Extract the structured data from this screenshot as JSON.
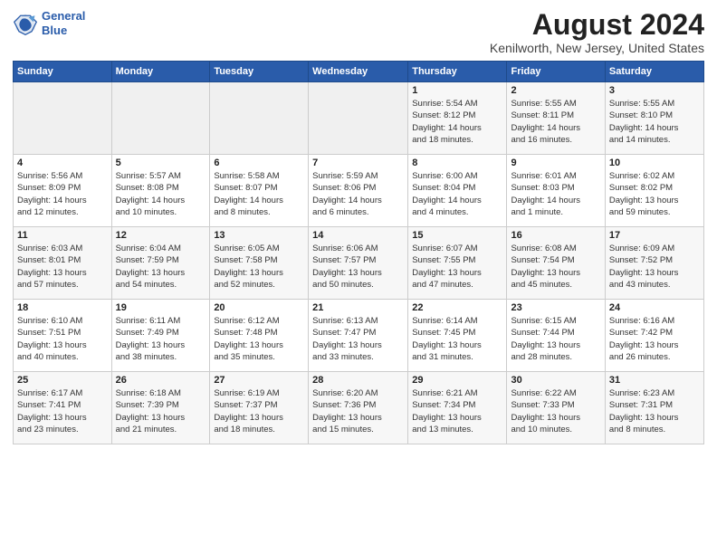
{
  "header": {
    "logo_line1": "General",
    "logo_line2": "Blue",
    "main_title": "August 2024",
    "sub_title": "Kenilworth, New Jersey, United States"
  },
  "weekdays": [
    "Sunday",
    "Monday",
    "Tuesday",
    "Wednesday",
    "Thursday",
    "Friday",
    "Saturday"
  ],
  "weeks": [
    [
      {
        "day": "",
        "info": ""
      },
      {
        "day": "",
        "info": ""
      },
      {
        "day": "",
        "info": ""
      },
      {
        "day": "",
        "info": ""
      },
      {
        "day": "1",
        "info": "Sunrise: 5:54 AM\nSunset: 8:12 PM\nDaylight: 14 hours\nand 18 minutes."
      },
      {
        "day": "2",
        "info": "Sunrise: 5:55 AM\nSunset: 8:11 PM\nDaylight: 14 hours\nand 16 minutes."
      },
      {
        "day": "3",
        "info": "Sunrise: 5:55 AM\nSunset: 8:10 PM\nDaylight: 14 hours\nand 14 minutes."
      }
    ],
    [
      {
        "day": "4",
        "info": "Sunrise: 5:56 AM\nSunset: 8:09 PM\nDaylight: 14 hours\nand 12 minutes."
      },
      {
        "day": "5",
        "info": "Sunrise: 5:57 AM\nSunset: 8:08 PM\nDaylight: 14 hours\nand 10 minutes."
      },
      {
        "day": "6",
        "info": "Sunrise: 5:58 AM\nSunset: 8:07 PM\nDaylight: 14 hours\nand 8 minutes."
      },
      {
        "day": "7",
        "info": "Sunrise: 5:59 AM\nSunset: 8:06 PM\nDaylight: 14 hours\nand 6 minutes."
      },
      {
        "day": "8",
        "info": "Sunrise: 6:00 AM\nSunset: 8:04 PM\nDaylight: 14 hours\nand 4 minutes."
      },
      {
        "day": "9",
        "info": "Sunrise: 6:01 AM\nSunset: 8:03 PM\nDaylight: 14 hours\nand 1 minute."
      },
      {
        "day": "10",
        "info": "Sunrise: 6:02 AM\nSunset: 8:02 PM\nDaylight: 13 hours\nand 59 minutes."
      }
    ],
    [
      {
        "day": "11",
        "info": "Sunrise: 6:03 AM\nSunset: 8:01 PM\nDaylight: 13 hours\nand 57 minutes."
      },
      {
        "day": "12",
        "info": "Sunrise: 6:04 AM\nSunset: 7:59 PM\nDaylight: 13 hours\nand 54 minutes."
      },
      {
        "day": "13",
        "info": "Sunrise: 6:05 AM\nSunset: 7:58 PM\nDaylight: 13 hours\nand 52 minutes."
      },
      {
        "day": "14",
        "info": "Sunrise: 6:06 AM\nSunset: 7:57 PM\nDaylight: 13 hours\nand 50 minutes."
      },
      {
        "day": "15",
        "info": "Sunrise: 6:07 AM\nSunset: 7:55 PM\nDaylight: 13 hours\nand 47 minutes."
      },
      {
        "day": "16",
        "info": "Sunrise: 6:08 AM\nSunset: 7:54 PM\nDaylight: 13 hours\nand 45 minutes."
      },
      {
        "day": "17",
        "info": "Sunrise: 6:09 AM\nSunset: 7:52 PM\nDaylight: 13 hours\nand 43 minutes."
      }
    ],
    [
      {
        "day": "18",
        "info": "Sunrise: 6:10 AM\nSunset: 7:51 PM\nDaylight: 13 hours\nand 40 minutes."
      },
      {
        "day": "19",
        "info": "Sunrise: 6:11 AM\nSunset: 7:49 PM\nDaylight: 13 hours\nand 38 minutes."
      },
      {
        "day": "20",
        "info": "Sunrise: 6:12 AM\nSunset: 7:48 PM\nDaylight: 13 hours\nand 35 minutes."
      },
      {
        "day": "21",
        "info": "Sunrise: 6:13 AM\nSunset: 7:47 PM\nDaylight: 13 hours\nand 33 minutes."
      },
      {
        "day": "22",
        "info": "Sunrise: 6:14 AM\nSunset: 7:45 PM\nDaylight: 13 hours\nand 31 minutes."
      },
      {
        "day": "23",
        "info": "Sunrise: 6:15 AM\nSunset: 7:44 PM\nDaylight: 13 hours\nand 28 minutes."
      },
      {
        "day": "24",
        "info": "Sunrise: 6:16 AM\nSunset: 7:42 PM\nDaylight: 13 hours\nand 26 minutes."
      }
    ],
    [
      {
        "day": "25",
        "info": "Sunrise: 6:17 AM\nSunset: 7:41 PM\nDaylight: 13 hours\nand 23 minutes."
      },
      {
        "day": "26",
        "info": "Sunrise: 6:18 AM\nSunset: 7:39 PM\nDaylight: 13 hours\nand 21 minutes."
      },
      {
        "day": "27",
        "info": "Sunrise: 6:19 AM\nSunset: 7:37 PM\nDaylight: 13 hours\nand 18 minutes."
      },
      {
        "day": "28",
        "info": "Sunrise: 6:20 AM\nSunset: 7:36 PM\nDaylight: 13 hours\nand 15 minutes."
      },
      {
        "day": "29",
        "info": "Sunrise: 6:21 AM\nSunset: 7:34 PM\nDaylight: 13 hours\nand 13 minutes."
      },
      {
        "day": "30",
        "info": "Sunrise: 6:22 AM\nSunset: 7:33 PM\nDaylight: 13 hours\nand 10 minutes."
      },
      {
        "day": "31",
        "info": "Sunrise: 6:23 AM\nSunset: 7:31 PM\nDaylight: 13 hours\nand 8 minutes."
      }
    ]
  ]
}
